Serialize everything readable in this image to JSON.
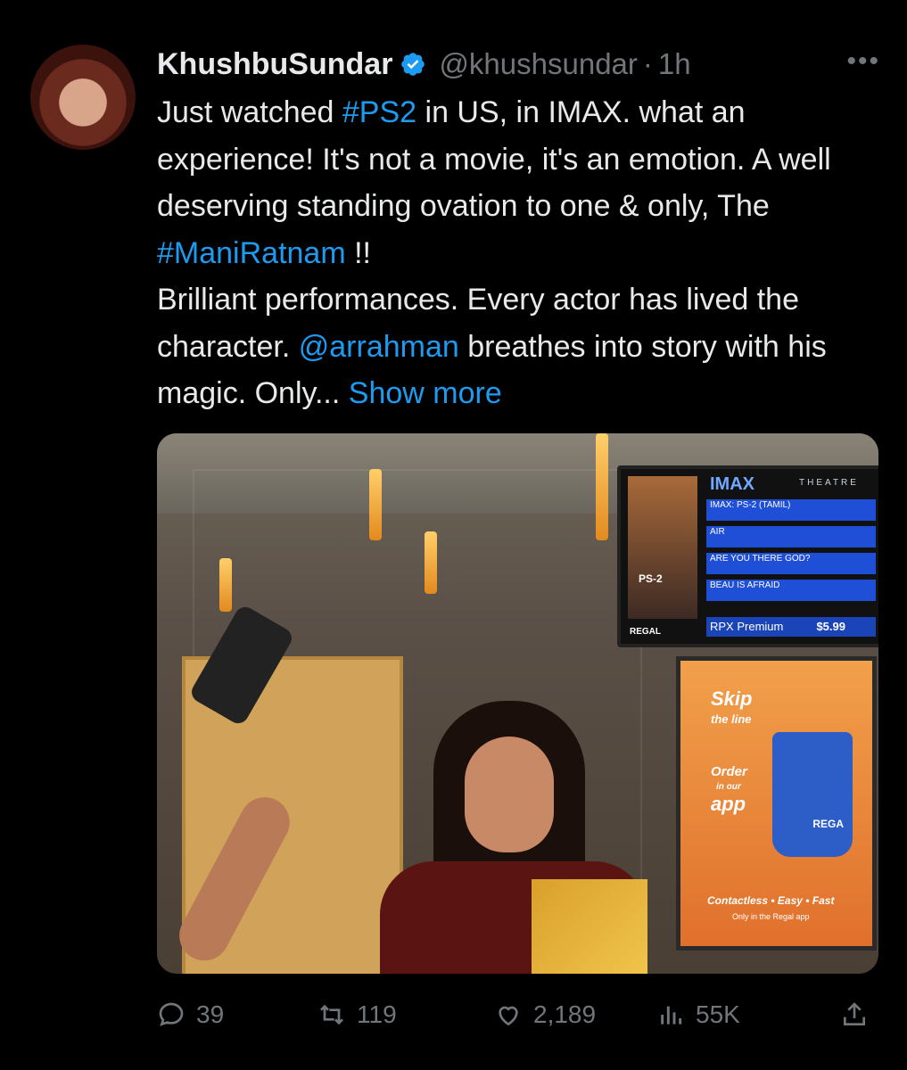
{
  "tweet": {
    "display_name": "KhushbuSundar",
    "handle": "@khushsundar",
    "separator": "·",
    "time": "1h",
    "more_label": "•••",
    "text": {
      "p1": "Just watched ",
      "tag1": "#PS2",
      "p2": " in US, in IMAX. what an experience! It's not a movie, it's an emotion. A well deserving standing ovation to one & only, The ",
      "tag2": "#ManiRatnam",
      "p3": " !!",
      "p4": "Brilliant performances. Every actor has lived the character. ",
      "mention": "@arrahman",
      "p5": " breathes into story with his magic. Only... ",
      "show_more": "Show more"
    },
    "media": {
      "tv": {
        "brand": "IMAX",
        "theatre": "THEATRE",
        "rows": [
          "IMAX: PS-2 (TAMIL)",
          "AIR",
          "ARE YOU THERE GOD?",
          "BEAU IS AFRAID"
        ],
        "premium": "RPX Premium",
        "price": "$5.99",
        "regal": "REGAL",
        "poster_label": "PS-2"
      },
      "ad": {
        "line1": "Skip",
        "line2": "the line",
        "line3": "Order",
        "line4": "in our",
        "line5": "app",
        "cup_label": "REGA",
        "footer1": "Contactless • Easy • Fast",
        "footer2": "Only in the Regal app"
      }
    },
    "actions": {
      "replies": "39",
      "retweets": "119",
      "likes": "2,189",
      "views": "55K"
    }
  },
  "colors": {
    "background": "#000000",
    "text": "#e7e9ea",
    "muted": "#71767b",
    "link": "#1d9bf0",
    "verified": "#1d9bf0"
  },
  "icons": [
    "reply-icon",
    "retweet-icon",
    "like-icon",
    "views-icon",
    "share-icon",
    "verified-badge-icon",
    "more-icon"
  ]
}
